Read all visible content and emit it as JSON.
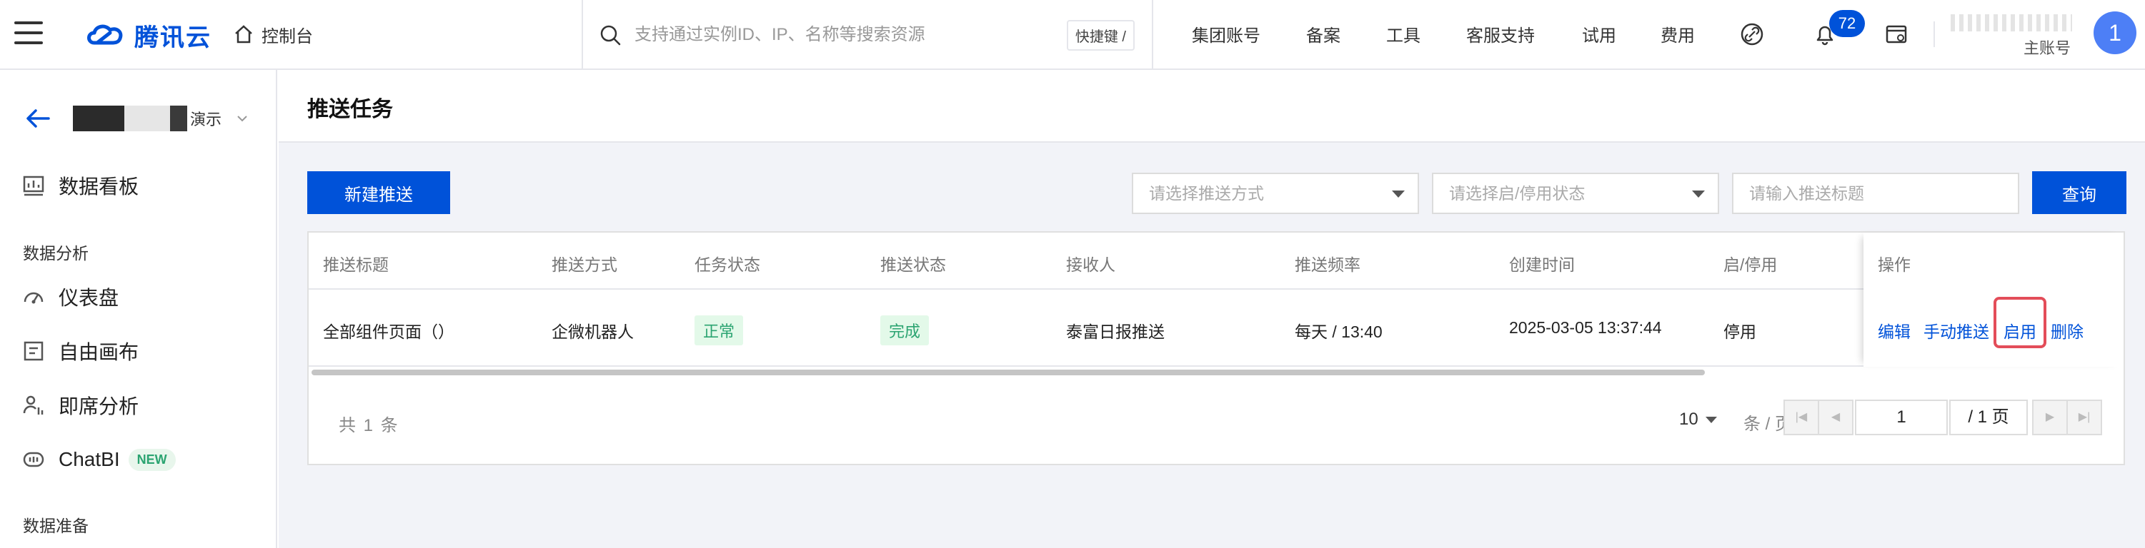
{
  "header": {
    "brand": "腾讯云",
    "console": "控制台",
    "search_placeholder": "支持通过实例ID、IP、名称等搜索资源",
    "shortcut": "快捷键 /",
    "nav": [
      "集团账号",
      "备案",
      "工具",
      "客服支持",
      "试用",
      "费用"
    ],
    "notification_count": "72",
    "account_label": "主账号",
    "avatar_text": "1",
    "brand_color": "#0052d9"
  },
  "sidebar": {
    "project_name": "演示",
    "items": [
      {
        "label": "数据看板",
        "icon": "dashboard-board-icon"
      }
    ],
    "group_analysis": "数据分析",
    "analysis_items": [
      {
        "label": "仪表盘",
        "icon": "gauge-icon"
      },
      {
        "label": "自由画布",
        "icon": "canvas-icon"
      },
      {
        "label": "即席分析",
        "icon": "adhoc-analysis-icon"
      },
      {
        "label": "ChatBI",
        "icon": "chat-icon",
        "badge": "NEW"
      }
    ],
    "group_prep": "数据准备"
  },
  "page": {
    "title": "推送任务",
    "new_button": "新建推送",
    "filter_method_placeholder": "请选择推送方式",
    "filter_status_placeholder": "请选择启/停用状态",
    "filter_title_placeholder": "请输入推送标题",
    "query_button": "查询"
  },
  "table": {
    "columns": [
      "推送标题",
      "推送方式",
      "任务状态",
      "推送状态",
      "接收人",
      "推送频率",
      "创建时间",
      "启/停用",
      "操作"
    ],
    "rows": [
      {
        "title": "全部组件页面（）",
        "method": "企微机器人",
        "task_status": "正常",
        "push_status": "完成",
        "receiver": "泰富日报推送",
        "frequency": "每天 / 13:40",
        "created": "2025-03-05 13:37:44",
        "enabled": "停用",
        "actions": [
          "编辑",
          "手动推送",
          "启用",
          "删除"
        ]
      }
    ]
  },
  "pagination": {
    "total": "共 1 条",
    "page_size": "10",
    "page_size_unit": "条 / 页",
    "current_page": "1",
    "total_pages": "/ 1 页"
  }
}
